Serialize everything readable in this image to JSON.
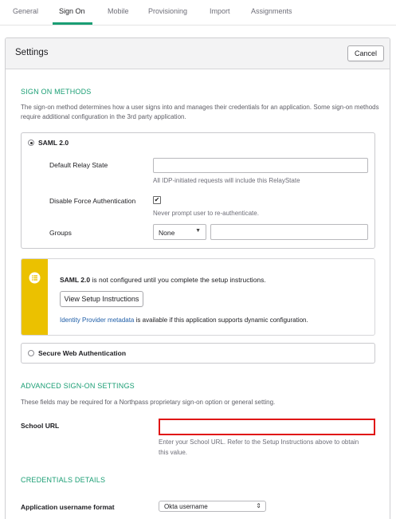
{
  "tabs": {
    "general": "General",
    "sign_on": "Sign On",
    "mobile": "Mobile",
    "provisioning": "Provisioning",
    "import": "Import",
    "assignments": "Assignments"
  },
  "settings": {
    "title": "Settings",
    "cancel_label": "Cancel"
  },
  "sign_on_methods": {
    "heading": "SIGN ON METHODS",
    "description": "The sign-on method determines how a user signs into and manages their credentials for an application. Some sign-on methods require additional configuration in the 3rd party application."
  },
  "saml": {
    "option_label": "SAML 2.0",
    "selected": true,
    "relay_state_label": "Default Relay State",
    "relay_state_value": "",
    "relay_state_hint": "All IDP-initiated requests will include this RelayState",
    "disable_force_label": "Disable Force Authentication",
    "disable_force_checked": "✔",
    "disable_force_hint": "Never prompt user to re-authenticate.",
    "groups_label": "Groups",
    "groups_select_value": "None",
    "groups_filter_value": ""
  },
  "notice": {
    "strong": "SAML 2.0",
    "text": " is not configured until you complete the setup instructions.",
    "button_label": "View Setup Instructions",
    "link_text": "Identity Provider metadata",
    "link_suffix": " is available if this application supports dynamic configuration."
  },
  "swa": {
    "option_label": "Secure Web Authentication",
    "selected": false
  },
  "advanced": {
    "heading": "ADVANCED SIGN-ON SETTINGS",
    "description": "These fields may be required for a Northpass proprietary sign-on option or general setting.",
    "school_url_label": "School URL",
    "school_url_value": "",
    "school_url_hint_line1": "Enter your School URL. Refer to the Setup Instructions above to obtain",
    "school_url_hint_line2": "this value."
  },
  "credentials": {
    "heading": "CREDENTIALS DETAILS",
    "username_format_label": "Application username format",
    "username_format_value": "Okta username"
  },
  "colors": {
    "accent": "#1a9e74",
    "notice_bar": "#ebc100",
    "required_border": "#e01616",
    "link": "#1f5ea8"
  }
}
